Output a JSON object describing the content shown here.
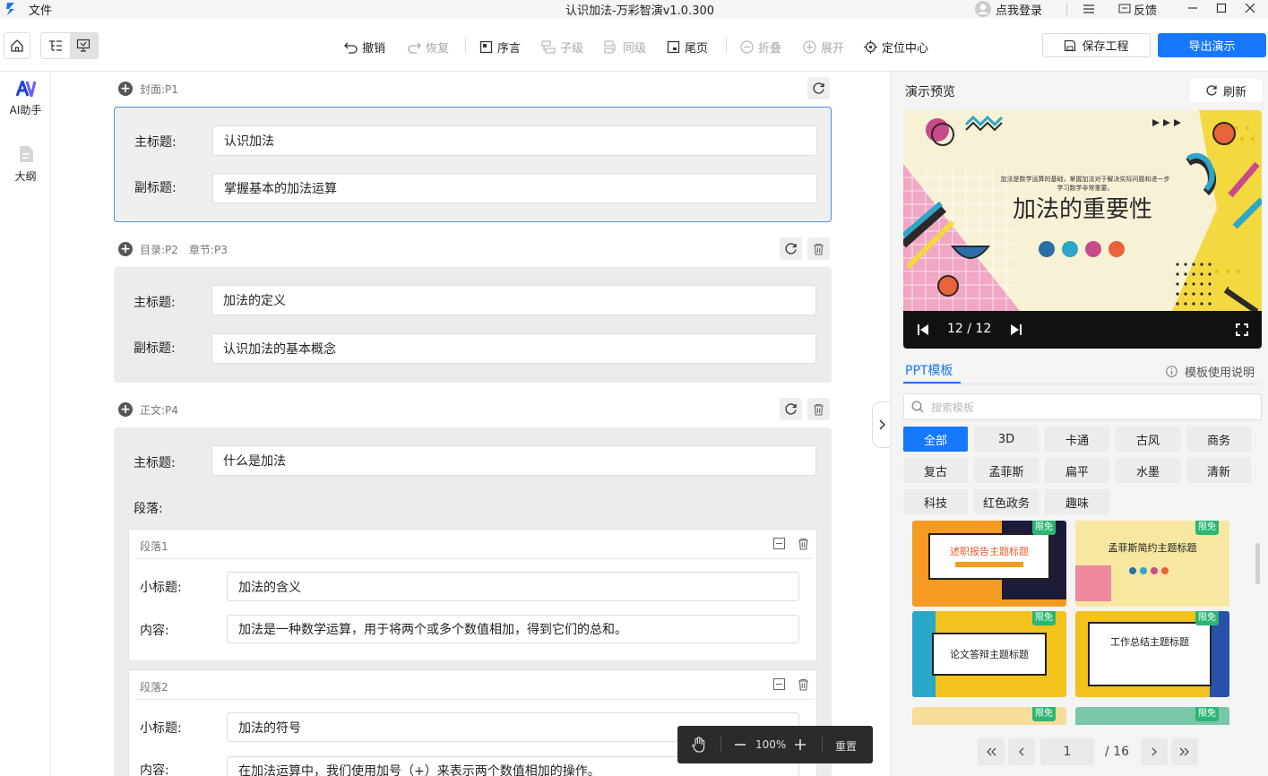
{
  "titlebar": {
    "menu_file": "文件",
    "title": "认识加法-万彩智演v1.0.300",
    "login": "点我登录",
    "feedback": "反馈"
  },
  "toolbar": {
    "undo": "撤销",
    "redo": "恢复",
    "preface": "序言",
    "child": "子级",
    "sibling": "同级",
    "end_page": "尾页",
    "collapse": "折叠",
    "expand": "展开",
    "locate_center": "定位中心",
    "save": "保存工程",
    "export": "导出演示"
  },
  "rail": {
    "ai": "AI助手",
    "outline": "大纲"
  },
  "outline": {
    "cover": {
      "head": "封面:P1",
      "title_label": "主标题:",
      "title": "认识加法",
      "subtitle_label": "副标题:",
      "subtitle": "掌握基本的加法运算"
    },
    "toc": {
      "head": "目录:P2",
      "head2": "章节:P3",
      "title_label": "主标题:",
      "title": "加法的定义",
      "subtitle_label": "副标题:",
      "subtitle": "认识加法的基本概念"
    },
    "body": {
      "head": "正文:P4",
      "title_label": "主标题:",
      "title": "什么是加法",
      "paragraphs_label": "段落:",
      "paragraphs": [
        {
          "head": "段落1",
          "sub_label": "小标题:",
          "sub": "加法的含义",
          "content_label": "内容:",
          "content": "加法是一种数学运算，用于将两个或多个数值相加，得到它们的总和。"
        },
        {
          "head": "段落2",
          "sub_label": "小标题:",
          "sub": "加法的符号",
          "content_label": "内容:",
          "content": "在加法运算中，我们使用加号（+）来表示两个数值相加的操作。"
        }
      ]
    }
  },
  "preview": {
    "label": "演示预览",
    "refresh": "刷新",
    "slide_title": "加法的重要性",
    "slide_text": "加法是数学运算的基础，掌握加法对于解决实际问题和进一步学习数学非常重要。",
    "counter": "12 / 12"
  },
  "templates": {
    "tab": "PPT模板",
    "help": "模板使用说明",
    "search_placeholder": "搜索模板",
    "categories": [
      "全部",
      "3D",
      "卡通",
      "古风",
      "商务",
      "复古",
      "孟菲斯",
      "扁平",
      "水墨",
      "清新",
      "科技",
      "红色政务",
      "趣味"
    ],
    "badge": "限免",
    "thumbs": [
      "述职报告主题标题",
      "孟菲斯简约主题标题",
      "论文答辩主题标题",
      "工作总结主题标题"
    ],
    "page_current": "1",
    "page_total": "/ 16"
  },
  "zoom": {
    "level": "100%",
    "reset": "重置"
  },
  "colors": {
    "accent": "#1677ff",
    "badge": "#2bb673"
  }
}
